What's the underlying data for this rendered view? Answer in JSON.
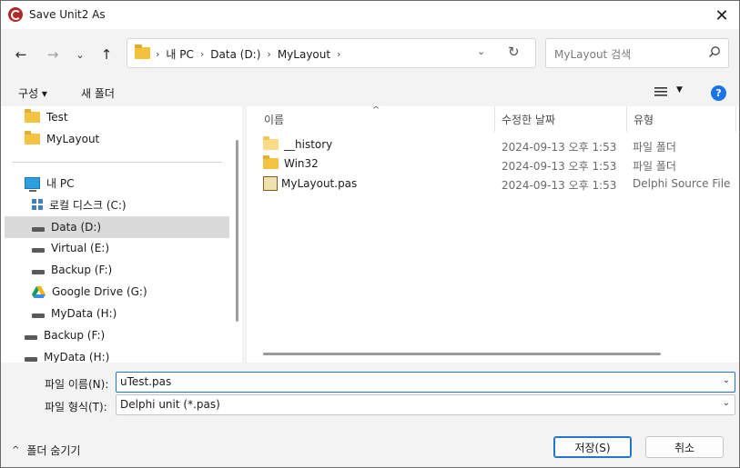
{
  "title": "Save Unit2 As",
  "address": {
    "crumbs": [
      "내 PC",
      "Data (D:)",
      "MyLayout"
    ]
  },
  "search": {
    "placeholder": "MyLayout 검색"
  },
  "toolbar": {
    "organize": "구성 ▾",
    "new_folder": "새 폴더"
  },
  "sidebar": {
    "items": [
      {
        "label": "Test",
        "icon": "folder-icon"
      },
      {
        "label": "MyLayout",
        "icon": "folder-icon"
      },
      {
        "label": "내 PC",
        "icon": "pc-icon"
      },
      {
        "label": "로컬 디스크 (C:)",
        "icon": "windows-drive-icon"
      },
      {
        "label": "Data (D:)",
        "icon": "drive-icon",
        "selected": true
      },
      {
        "label": "Virtual (E:)",
        "icon": "drive-icon"
      },
      {
        "label": "Backup (F:)",
        "icon": "drive-icon"
      },
      {
        "label": "Google Drive (G:)",
        "icon": "google-drive-icon"
      },
      {
        "label": "MyData (H:)",
        "icon": "drive-icon"
      },
      {
        "label": "Backup (F:)",
        "icon": "drive-icon"
      },
      {
        "label": "MyData (H:)",
        "icon": "drive-icon"
      }
    ]
  },
  "columns": [
    "이름",
    "수정한 날짜",
    "유형"
  ],
  "files": [
    {
      "name": "__history",
      "date": "2024-09-13 오후 1:53",
      "type": "파일 폴더",
      "icon": "folder-icon"
    },
    {
      "name": "Win32",
      "date": "2024-09-13 오후 1:53",
      "type": "파일 폴더",
      "icon": "folder-icon"
    },
    {
      "name": "MyLayout.pas",
      "date": "2024-09-13 오후 1:53",
      "type": "Delphi Source File",
      "icon": "pas-file-icon"
    }
  ],
  "filename": {
    "label": "파일 이름(N):",
    "value": "uTest.pas"
  },
  "filetype": {
    "label": "파일 형식(T):",
    "value": "Delphi unit (*.pas)"
  },
  "footer": {
    "hide_folders": "폴더 숨기기",
    "save": "저장(S)",
    "cancel": "취소"
  },
  "colors": {
    "accent": "#2276cf",
    "selected_bg": "#dadada",
    "help": "#1a73e8"
  }
}
